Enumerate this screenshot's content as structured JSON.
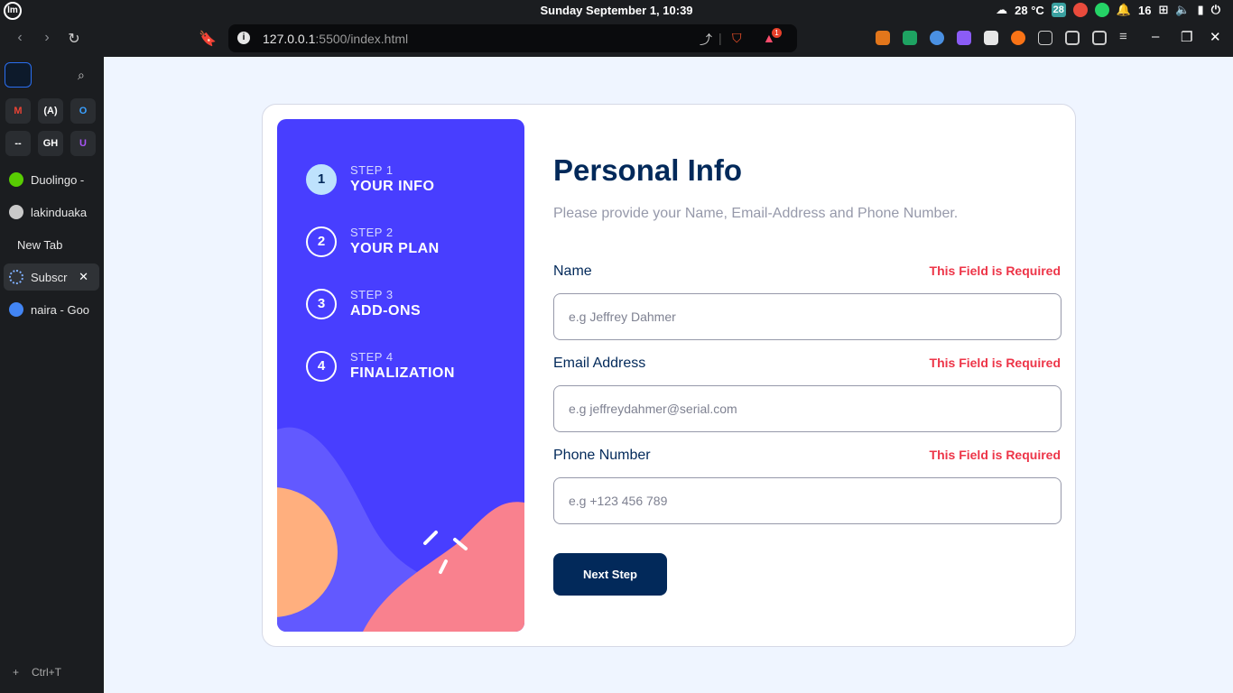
{
  "system": {
    "clock": "Sunday September  1, 10:39",
    "temperature": "28 °C",
    "tray_count": "16",
    "tray_badge": "28"
  },
  "browser": {
    "url_host": "127.0.0.1",
    "url_rest": ":5500/index.html",
    "shields_badge": "1"
  },
  "sidebar": {
    "pinned": [
      "M",
      "(A)",
      "O",
      "--",
      "GH",
      "U"
    ],
    "tabs": [
      {
        "label": "Duolingo -",
        "color": "#58cc02"
      },
      {
        "label": "lakinduaka",
        "color": "#c9c9c9"
      },
      {
        "label": "New Tab",
        "color": ""
      },
      {
        "label": "Subscr",
        "color": "#7fb0ff"
      },
      {
        "label": "naira - Goo",
        "color": "#4285f4"
      }
    ],
    "new_tab_shortcut": "Ctrl+T"
  },
  "steps": [
    {
      "number": "1",
      "label": "STEP 1",
      "title": "YOUR INFO",
      "active": true
    },
    {
      "number": "2",
      "label": "STEP 2",
      "title": "YOUR PLAN",
      "active": false
    },
    {
      "number": "3",
      "label": "STEP 3",
      "title": "ADD-ONS",
      "active": false
    },
    {
      "number": "4",
      "label": "STEP 4",
      "title": "FINALIZATION",
      "active": false
    }
  ],
  "form": {
    "title": "Personal Info",
    "subtitle": "Please provide your Name, Email-Address and Phone Number.",
    "fields": [
      {
        "label": "Name",
        "error": "This Field is Required",
        "placeholder": "e.g Jeffrey Dahmer",
        "value": ""
      },
      {
        "label": "Email Address",
        "error": "This Field is Required",
        "placeholder": "e.g jeffreydahmer@serial.com",
        "value": ""
      },
      {
        "label": "Phone Number",
        "error": "This Field is Required",
        "placeholder": "e.g +123 456 789",
        "value": ""
      }
    ],
    "next_button": "Next Step"
  },
  "colors": {
    "panel": "#483eff",
    "primary": "#02295a",
    "error": "#ed3548",
    "active_step": "#bee2fd"
  }
}
